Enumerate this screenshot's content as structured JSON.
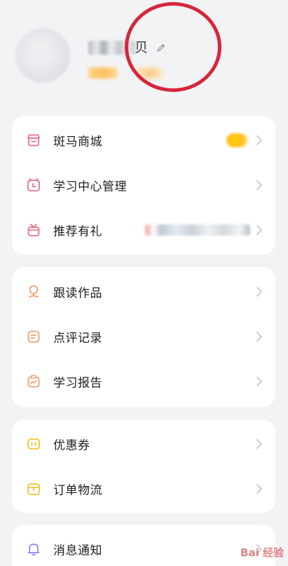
{
  "profile": {
    "username_visible_char": "贝",
    "icons": {
      "edit": "pencil-icon"
    }
  },
  "colors": {
    "background": "#f2f3f5",
    "card": "#ffffff",
    "annotation": "#d6263b",
    "pink": "#e8708a",
    "orange": "#f0a070",
    "yellow": "#f2c230",
    "purple": "#8c8ef0",
    "chevron": "#c4c6cc"
  },
  "menu_groups": [
    {
      "items": [
        {
          "label": "斑马商城",
          "icon": "store-icon"
        },
        {
          "label": "学习中心管理",
          "icon": "alarm-clock-icon"
        },
        {
          "label": "推荐有礼",
          "icon": "gift-icon"
        }
      ]
    },
    {
      "items": [
        {
          "label": "跟读作品",
          "icon": "microphone-icon"
        },
        {
          "label": "点评记录",
          "icon": "comment-icon"
        },
        {
          "label": "学习报告",
          "icon": "report-icon"
        }
      ]
    },
    {
      "items": [
        {
          "label": "优惠券",
          "icon": "coupon-icon"
        },
        {
          "label": "订单物流",
          "icon": "package-icon"
        }
      ]
    },
    {
      "items": [
        {
          "label": "消息通知",
          "icon": "bell-icon"
        }
      ]
    }
  ],
  "watermark": "Bai 经验"
}
